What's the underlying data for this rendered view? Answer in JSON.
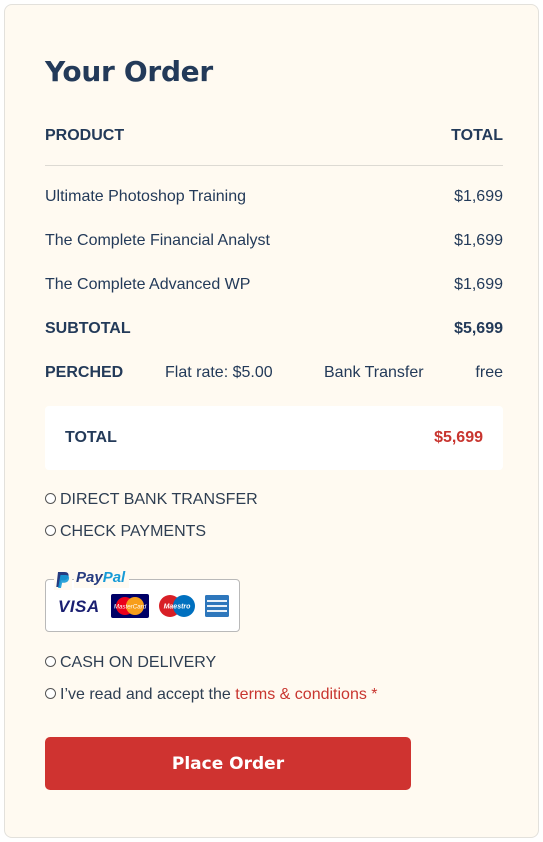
{
  "order": {
    "title": "Your Order",
    "header": {
      "product": "PRODUCT",
      "total": "TOTAL"
    },
    "items": [
      {
        "name": "Ultimate Photoshop Training",
        "price": "$1,699"
      },
      {
        "name": "The Complete Financial Analyst",
        "price": "$1,699"
      },
      {
        "name": "The Complete Advanced WP",
        "price": "$1,699"
      }
    ],
    "subtotal": {
      "label": "SUBTOTAL",
      "value": "$5,699"
    },
    "shipping": {
      "label": "PERCHED",
      "flat_rate": "Flat rate: $5.00",
      "bank_transfer": "Bank Transfer",
      "free": "free"
    },
    "total": {
      "label": "TOTAL",
      "value": "$5,699"
    }
  },
  "payment": {
    "options": [
      {
        "label": "DIRECT BANK TRANSFER",
        "checked": false
      },
      {
        "label": "CHECK PAYMENTS",
        "checked": false
      }
    ],
    "paypal": {
      "word_1": "Pay",
      "word_2": "Pal",
      "visa": "VISA",
      "mastercard": "MasterCard",
      "maestro": "Maestro"
    },
    "cod": {
      "label": "CASH ON DELIVERY",
      "checked": false
    },
    "terms": {
      "prefix": "I’ve read and accept the ",
      "link": "terms & conditions *",
      "checked": false
    }
  },
  "place_order": {
    "label": "Place Order"
  },
  "colors": {
    "accent": "#cf3330",
    "heading": "#233a59",
    "background": "#fffaf1"
  }
}
